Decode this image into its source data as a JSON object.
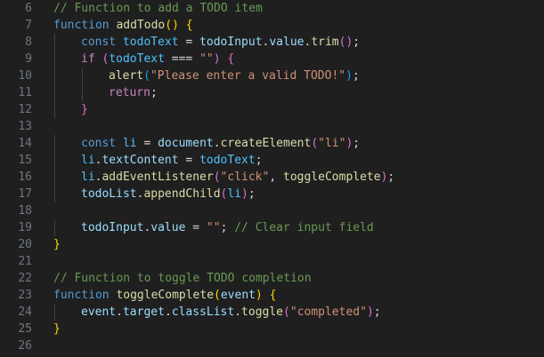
{
  "editor": {
    "lines": [
      {
        "n": "6",
        "indent": 0,
        "tokens": [
          {
            "t": "// Function to add a TODO item",
            "c": "comment"
          }
        ]
      },
      {
        "n": "7",
        "indent": 0,
        "tokens": [
          {
            "t": "function ",
            "c": "keyword"
          },
          {
            "t": "addTodo",
            "c": "func"
          },
          {
            "t": "()",
            "c": "b1"
          },
          {
            "t": " ",
            "c": "punc"
          },
          {
            "t": "{",
            "c": "b1"
          }
        ]
      },
      {
        "n": "8",
        "indent": 1,
        "tokens": [
          {
            "t": "const ",
            "c": "keyword"
          },
          {
            "t": "todoText",
            "c": "const"
          },
          {
            "t": " = ",
            "c": "punc"
          },
          {
            "t": "todoInput",
            "c": "var"
          },
          {
            "t": ".",
            "c": "punc"
          },
          {
            "t": "value",
            "c": "var"
          },
          {
            "t": ".",
            "c": "punc"
          },
          {
            "t": "trim",
            "c": "func"
          },
          {
            "t": "()",
            "c": "b2"
          },
          {
            "t": ";",
            "c": "punc"
          }
        ]
      },
      {
        "n": "9",
        "indent": 1,
        "tokens": [
          {
            "t": "if ",
            "c": "control"
          },
          {
            "t": "(",
            "c": "b2"
          },
          {
            "t": "todoText",
            "c": "const"
          },
          {
            "t": " === ",
            "c": "punc"
          },
          {
            "t": "\"\"",
            "c": "string"
          },
          {
            "t": ")",
            "c": "b2"
          },
          {
            "t": " ",
            "c": "punc"
          },
          {
            "t": "{",
            "c": "b2"
          }
        ]
      },
      {
        "n": "10",
        "indent": 2,
        "tokens": [
          {
            "t": "alert",
            "c": "func"
          },
          {
            "t": "(",
            "c": "b3"
          },
          {
            "t": "\"Please enter a valid TODO!\"",
            "c": "string"
          },
          {
            "t": ")",
            "c": "b3"
          },
          {
            "t": ";",
            "c": "punc"
          }
        ]
      },
      {
        "n": "11",
        "indent": 2,
        "tokens": [
          {
            "t": "return",
            "c": "control"
          },
          {
            "t": ";",
            "c": "punc"
          }
        ]
      },
      {
        "n": "12",
        "indent": 1,
        "tokens": [
          {
            "t": "}",
            "c": "b2"
          }
        ]
      },
      {
        "n": "13",
        "indent": 0,
        "tokens": []
      },
      {
        "n": "14",
        "indent": 1,
        "tokens": [
          {
            "t": "const ",
            "c": "keyword"
          },
          {
            "t": "li",
            "c": "const"
          },
          {
            "t": " = ",
            "c": "punc"
          },
          {
            "t": "document",
            "c": "var"
          },
          {
            "t": ".",
            "c": "punc"
          },
          {
            "t": "createElement",
            "c": "func"
          },
          {
            "t": "(",
            "c": "b2"
          },
          {
            "t": "\"li\"",
            "c": "string"
          },
          {
            "t": ")",
            "c": "b2"
          },
          {
            "t": ";",
            "c": "punc"
          }
        ]
      },
      {
        "n": "15",
        "indent": 1,
        "tokens": [
          {
            "t": "li",
            "c": "const"
          },
          {
            "t": ".",
            "c": "punc"
          },
          {
            "t": "textContent",
            "c": "var"
          },
          {
            "t": " = ",
            "c": "punc"
          },
          {
            "t": "todoText",
            "c": "const"
          },
          {
            "t": ";",
            "c": "punc"
          }
        ]
      },
      {
        "n": "16",
        "indent": 1,
        "tokens": [
          {
            "t": "li",
            "c": "const"
          },
          {
            "t": ".",
            "c": "punc"
          },
          {
            "t": "addEventListener",
            "c": "func"
          },
          {
            "t": "(",
            "c": "b2"
          },
          {
            "t": "\"click\"",
            "c": "string"
          },
          {
            "t": ", ",
            "c": "punc"
          },
          {
            "t": "toggleComplete",
            "c": "func"
          },
          {
            "t": ")",
            "c": "b2"
          },
          {
            "t": ";",
            "c": "punc"
          }
        ]
      },
      {
        "n": "17",
        "indent": 1,
        "tokens": [
          {
            "t": "todoList",
            "c": "var"
          },
          {
            "t": ".",
            "c": "punc"
          },
          {
            "t": "appendChild",
            "c": "func"
          },
          {
            "t": "(",
            "c": "b2"
          },
          {
            "t": "li",
            "c": "const"
          },
          {
            "t": ")",
            "c": "b2"
          },
          {
            "t": ";",
            "c": "punc"
          }
        ]
      },
      {
        "n": "18",
        "indent": 0,
        "tokens": []
      },
      {
        "n": "19",
        "indent": 1,
        "tokens": [
          {
            "t": "todoInput",
            "c": "var"
          },
          {
            "t": ".",
            "c": "punc"
          },
          {
            "t": "value",
            "c": "var"
          },
          {
            "t": " = ",
            "c": "punc"
          },
          {
            "t": "\"\"",
            "c": "string"
          },
          {
            "t": "; ",
            "c": "punc"
          },
          {
            "t": "// Clear input field",
            "c": "comment"
          }
        ]
      },
      {
        "n": "20",
        "indent": 0,
        "tokens": [
          {
            "t": "}",
            "c": "b1"
          }
        ]
      },
      {
        "n": "21",
        "indent": 0,
        "tokens": []
      },
      {
        "n": "22",
        "indent": 0,
        "tokens": [
          {
            "t": "// Function to toggle TODO completion",
            "c": "comment"
          }
        ]
      },
      {
        "n": "23",
        "indent": 0,
        "tokens": [
          {
            "t": "function ",
            "c": "keyword"
          },
          {
            "t": "toggleComplete",
            "c": "func"
          },
          {
            "t": "(",
            "c": "b1"
          },
          {
            "t": "event",
            "c": "var"
          },
          {
            "t": ")",
            "c": "b1"
          },
          {
            "t": " ",
            "c": "punc"
          },
          {
            "t": "{",
            "c": "b1"
          }
        ]
      },
      {
        "n": "24",
        "indent": 1,
        "tokens": [
          {
            "t": "event",
            "c": "var"
          },
          {
            "t": ".",
            "c": "punc"
          },
          {
            "t": "target",
            "c": "var"
          },
          {
            "t": ".",
            "c": "punc"
          },
          {
            "t": "classList",
            "c": "var"
          },
          {
            "t": ".",
            "c": "punc"
          },
          {
            "t": "toggle",
            "c": "func"
          },
          {
            "t": "(",
            "c": "b2"
          },
          {
            "t": "\"completed\"",
            "c": "string"
          },
          {
            "t": ")",
            "c": "b2"
          },
          {
            "t": ";",
            "c": "punc"
          }
        ]
      },
      {
        "n": "25",
        "indent": 0,
        "tokens": [
          {
            "t": "}",
            "c": "b1"
          }
        ]
      },
      {
        "n": "26",
        "indent": 0,
        "tokens": []
      }
    ]
  },
  "colors": {
    "background": "#1f1f1f",
    "line_number": "#6e7681",
    "comment": "#6a9955",
    "keyword": "#569cd6",
    "control": "#c586c0",
    "function": "#dcdcaa",
    "variable": "#9cdcfe",
    "constant": "#4fc1ff",
    "string": "#ce9178",
    "bracket_1": "#ffd700",
    "bracket_2": "#da70d6",
    "bracket_3": "#179fff"
  }
}
